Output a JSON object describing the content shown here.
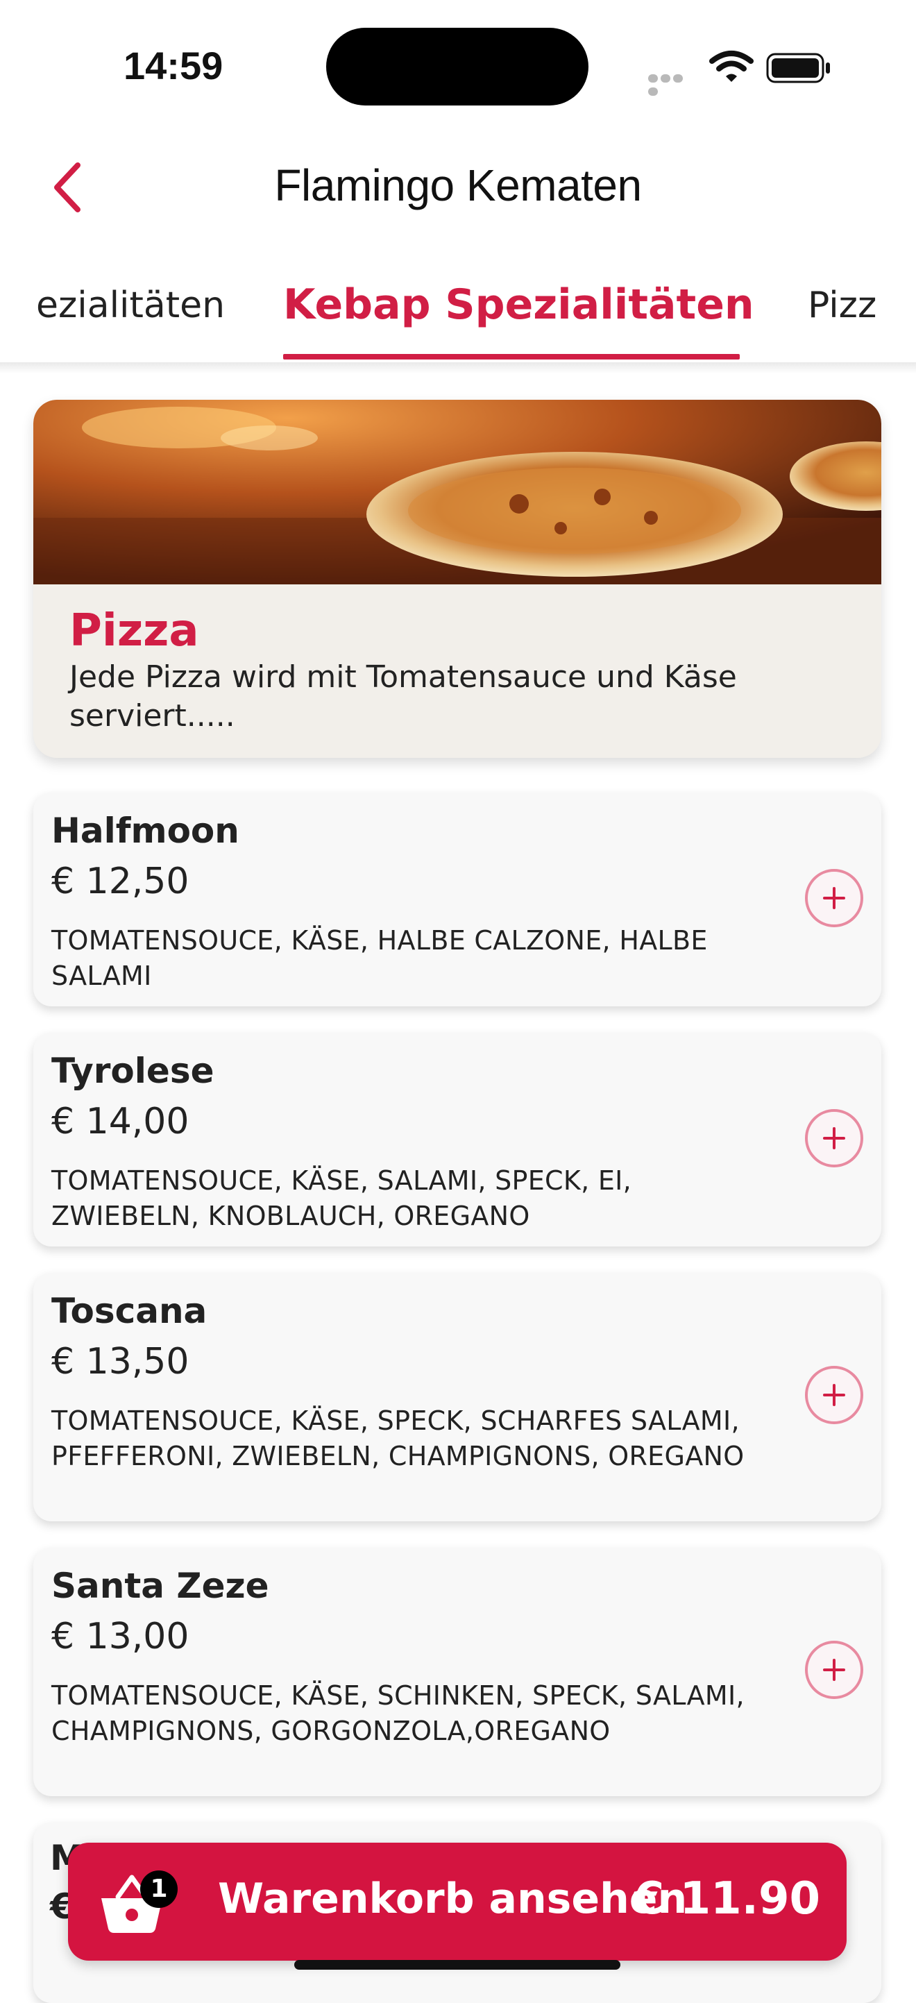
{
  "status_bar": {
    "time": "14:59"
  },
  "header": {
    "title": "Flamingo Kematen"
  },
  "tabs": [
    {
      "label": "ezialitäten",
      "active": false
    },
    {
      "label": "Kebap Spezialitäten",
      "active": true
    },
    {
      "label": "Pizz",
      "active": false
    }
  ],
  "category": {
    "title": "Pizza",
    "description": "Jede Pizza wird mit Tomatensauce und Käse serviert....."
  },
  "products": [
    {
      "name": "Halfmoon",
      "price": "€ 12,50",
      "description": "TOMATENSOUCE, KÄSE, HALBE CALZONE, HALBE SALAMI"
    },
    {
      "name": "Tyrolese",
      "price": "€ 14,00",
      "description": "TOMATENSOUCE, KÄSE, SALAMI, SPECK, EI, ZWIEBELN, KNOBLAUCH, OREGANO"
    },
    {
      "name": "Toscana",
      "price": "€ 13,50",
      "description": "TOMATENSOUCE, KÄSE, SPECK, SCHARFES SALAMI, PFEFFERONI, ZWIEBELN, CHAMPIGNONS, OREGANO"
    },
    {
      "name": "Santa Zeze",
      "price": "€ 13,00",
      "description": "TOMATENSOUCE, KÄSE, SCHINKEN, SPECK, SALAMI, CHAMPIGNONS, GORGONZOLA,OREGANO"
    }
  ],
  "partial_product": {
    "name_start": "M",
    "price_start": "€"
  },
  "cart": {
    "count": "1",
    "label": "Warenkorb ansehen",
    "total": "€ 11.90"
  },
  "colors": {
    "accent": "#d11e45",
    "cart_bg": "#d41440",
    "card_bg": "#f8f8f8",
    "banner_bg": "#f2efea"
  },
  "icons": [
    "back-chevron-icon",
    "wifi-icon",
    "battery-icon",
    "plus-icon",
    "basket-icon"
  ]
}
